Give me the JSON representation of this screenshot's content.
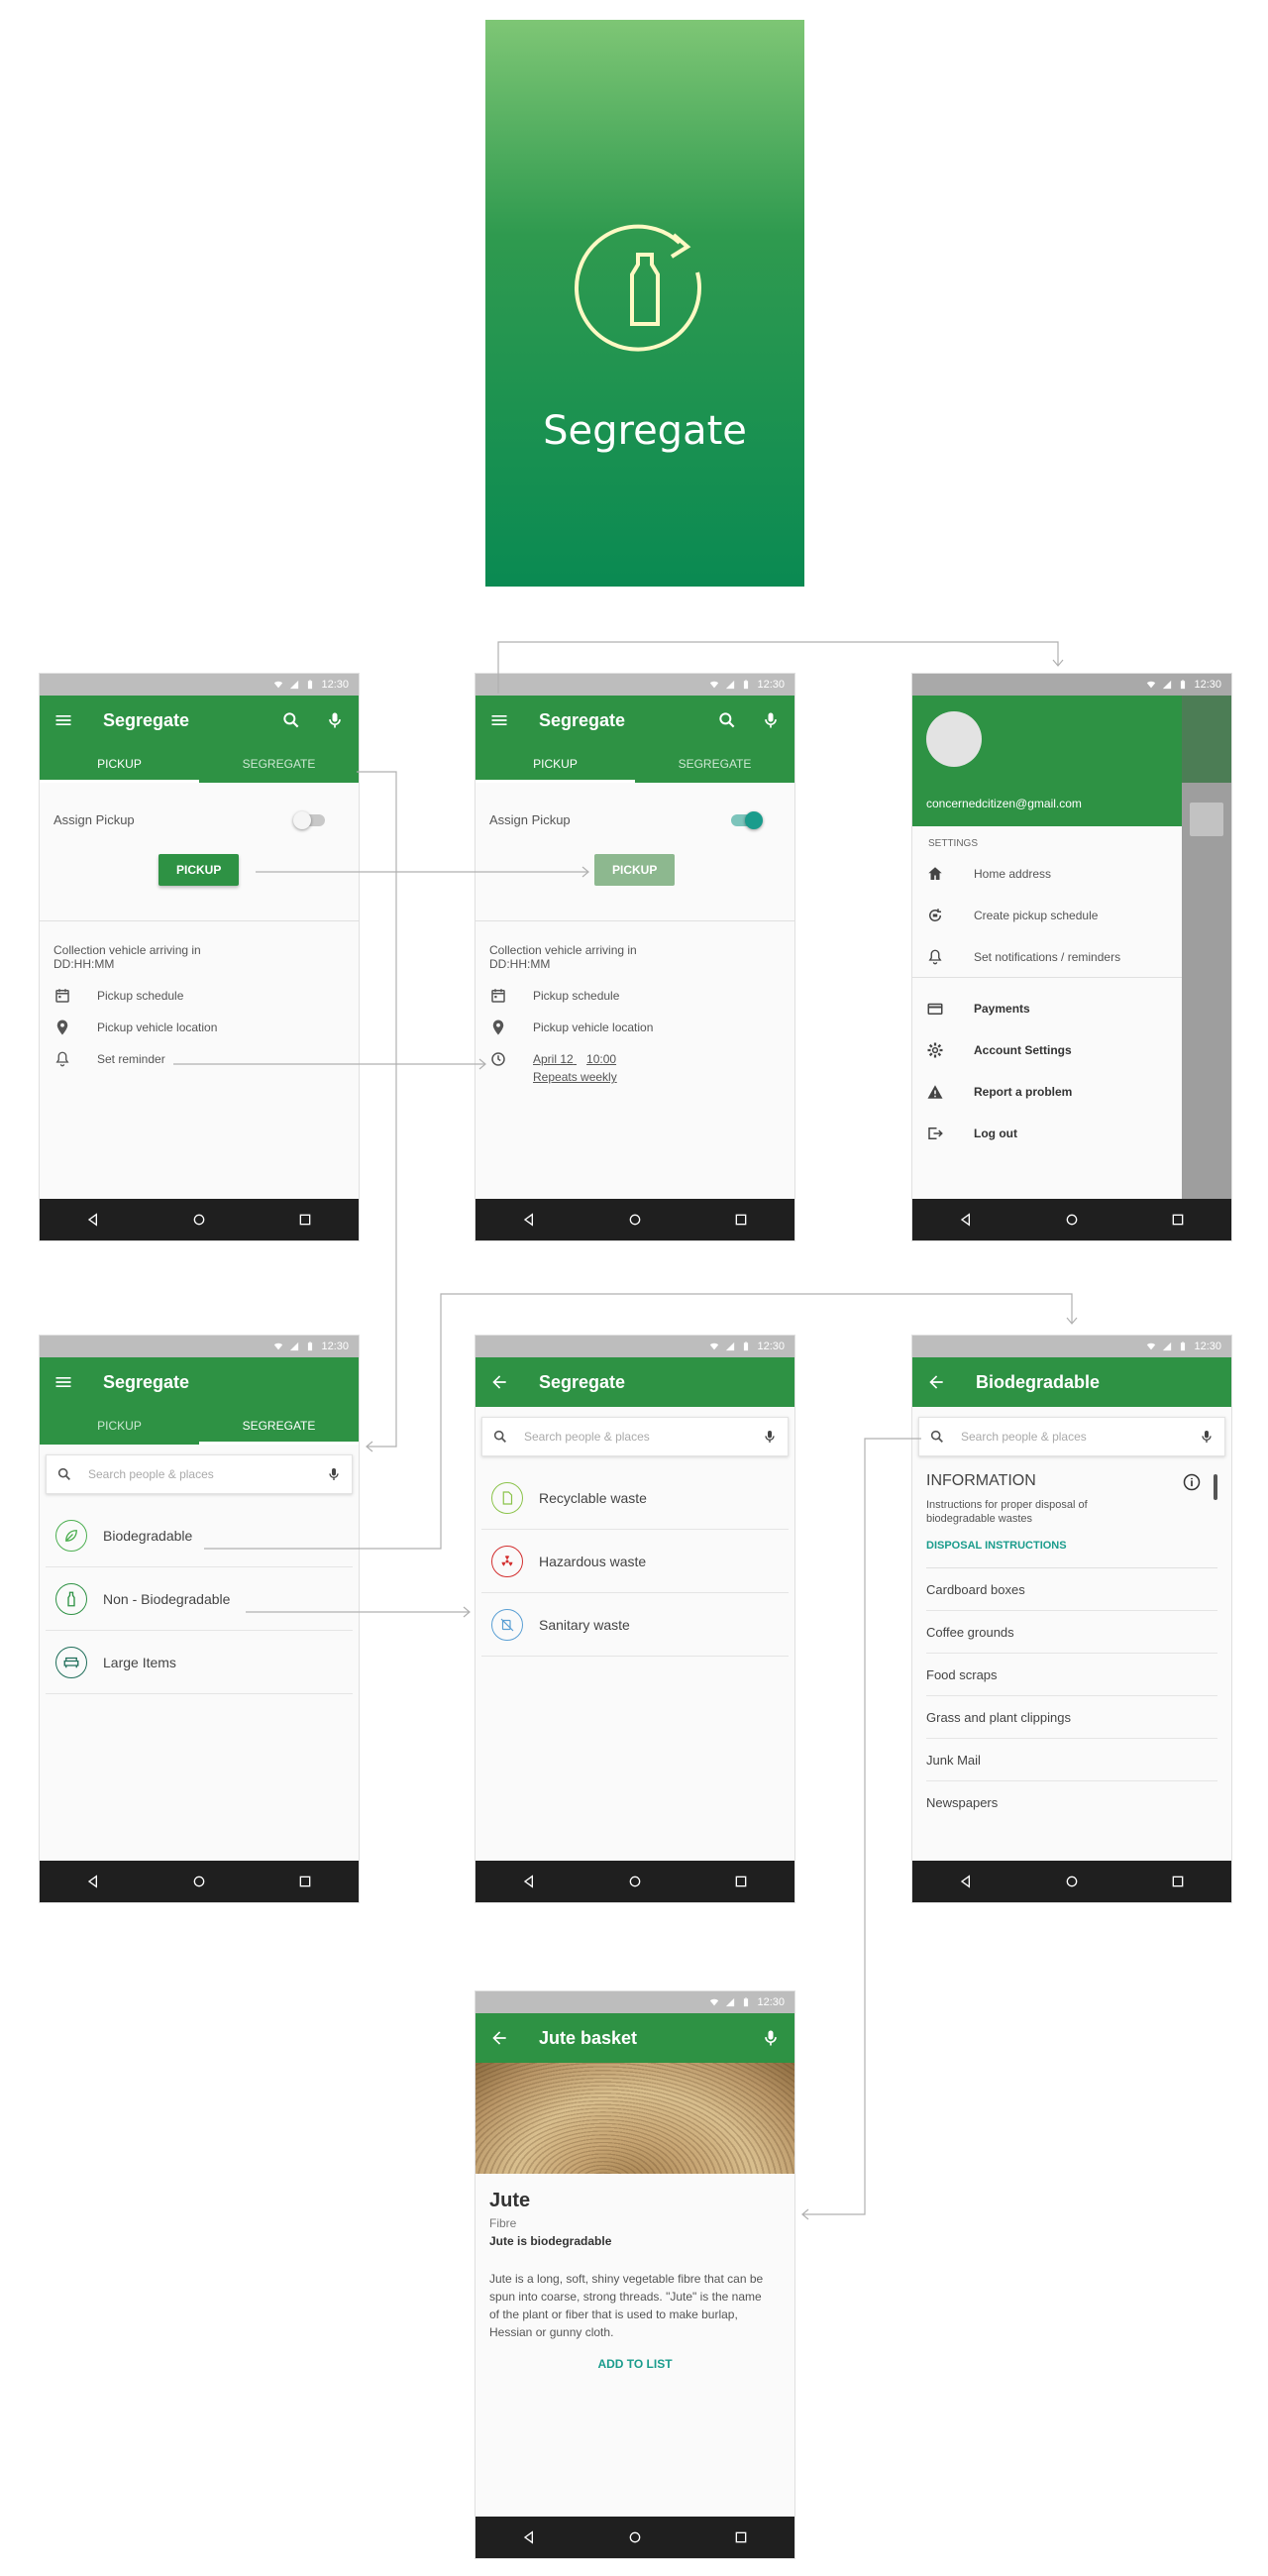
{
  "status": {
    "time": "12:30"
  },
  "splash": {
    "title": "Segregate",
    "logo_icon": "recycle-bottle-icon"
  },
  "app": {
    "title": "Segregate"
  },
  "tabs": {
    "pickup": "PICKUP",
    "segregate": "SEGREGATE"
  },
  "pickup": {
    "assign_label": "Assign Pickup",
    "button_label": "PICKUP",
    "arrival_text": "Collection vehicle arriving in",
    "arrival_time": "DD:HH:MM",
    "items": {
      "schedule": "Pickup schedule",
      "location": "Pickup vehicle location",
      "reminder": "Set reminder"
    },
    "reminder_date": "April 12",
    "reminder_time": "10:00",
    "reminder_repeat": "Repeats weekly"
  },
  "drawer": {
    "email": "concernedcitizen@gmail.com",
    "settings_header": "SETTINGS",
    "items": [
      "Home address",
      "Create pickup schedule",
      "Set notifications / reminders",
      "Payments",
      "Account Settings",
      "Report a problem",
      "Log out"
    ]
  },
  "search": {
    "placeholder": "Search people & places"
  },
  "segregate_categories": [
    "Biodegradable",
    "Non - Biodegradable",
    "Large Items"
  ],
  "non_bio_items": [
    "Recyclable waste",
    "Hazardous waste",
    "Sanitary waste"
  ],
  "biodegradable": {
    "title": "Biodegradable",
    "info_header": "INFORMATION",
    "info_desc": "Instructions for proper disposal of biodegradable wastes",
    "disposal_link": "DISPOSAL INSTRUCTIONS",
    "items": [
      "Cardboard boxes",
      "Coffee grounds",
      "Food scraps",
      "Grass and plant clippings",
      "Junk Mail",
      "Newspapers"
    ]
  },
  "jute": {
    "title": "Jute basket",
    "name": "Jute",
    "type": "Fibre",
    "status": "Jute is biodegradable",
    "description": "Jute is a long, soft, shiny vegetable fibre that can be spun into coarse, strong threads. \"Jute\" is the name of the plant or fiber that is used to make burlap, Hessian or gunny cloth.",
    "action": "ADD TO LIST"
  },
  "colors": {
    "primary": "#2e9244",
    "teal": "#1a9c8c",
    "hazard": "#d32f2f",
    "sanitary": "#5a9fd4"
  }
}
